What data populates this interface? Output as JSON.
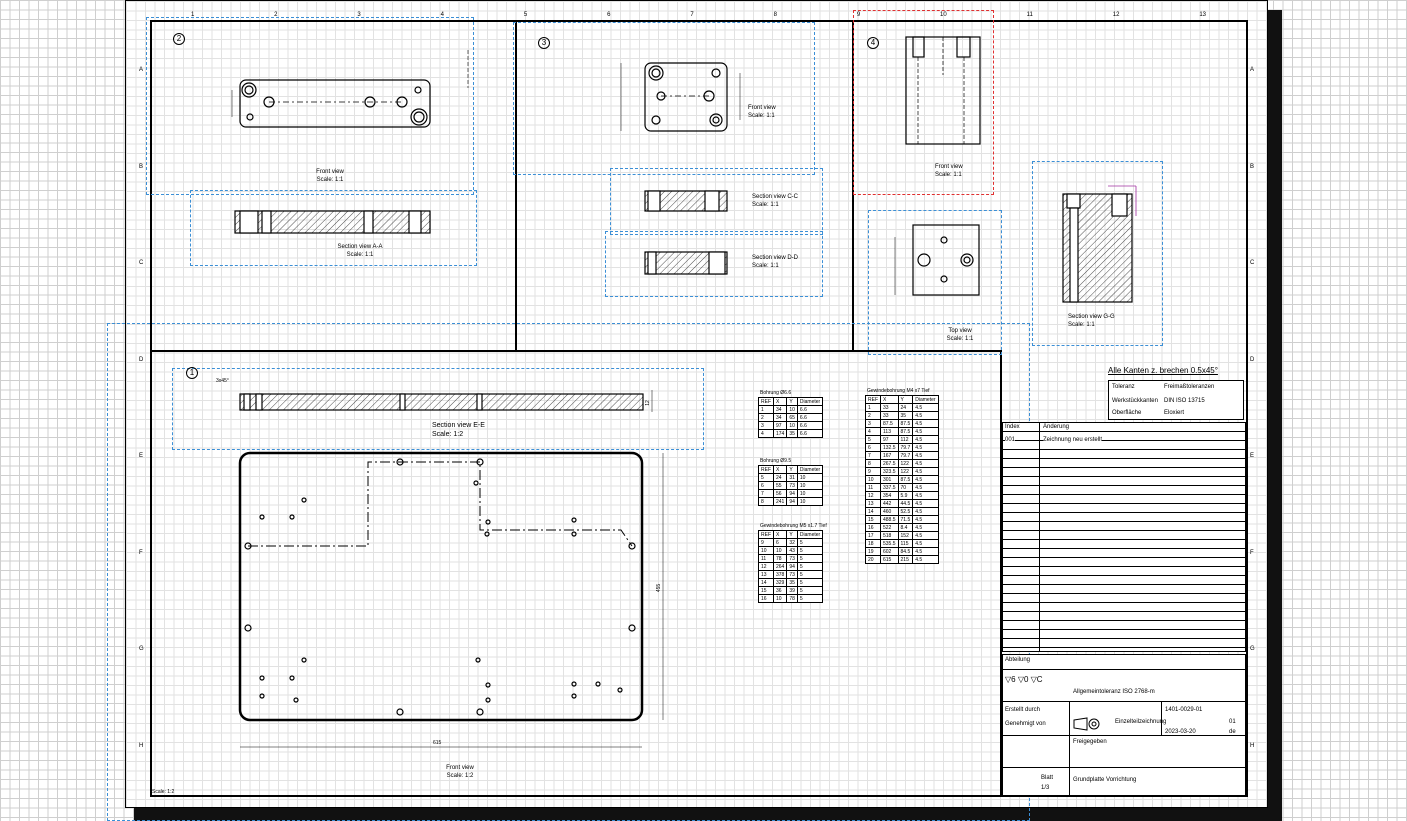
{
  "sheet": {
    "column_markers": [
      "1",
      "2",
      "3",
      "4",
      "5",
      "6",
      "7",
      "8",
      "9",
      "10",
      "11",
      "12",
      "13"
    ],
    "row_markers": [
      "A",
      "B",
      "C",
      "D",
      "E",
      "F",
      "G",
      "H"
    ],
    "footer_note": "Scale: 1:2"
  },
  "views": {
    "callouts": [
      "2",
      "3",
      "4",
      "1"
    ],
    "v2_front": "Front view\nScale: 1:1",
    "v2_section": "Section view A-A\nScale: 1:1",
    "v3_front": "Front view\nScale: 1:1",
    "v3_section_c": "Section view C-C\nScale: 1:1",
    "v3_section_d": "Section view D-D\nScale: 1:1",
    "v4_front": "Front view\nScale: 1:1",
    "v4_top": "Top view\nScale: 1:1",
    "v4_section": "Section view G-G\nScale: 1:1",
    "v1_section": "Section view E-E\nScale: 1:2",
    "v1_front": "Front view\nScale: 1:2",
    "dim_width": "615",
    "dim_height": "455",
    "dim_thk": "12",
    "edge_note": "3x45°"
  },
  "tables": {
    "t1": {
      "title": "Bohrung Ø6.6",
      "rows": [
        [
          "REF",
          "X",
          "Y",
          "Diameter"
        ],
        [
          "1",
          "34",
          "10",
          "6.6"
        ],
        [
          "2",
          "34",
          "65",
          "6.6"
        ],
        [
          "3",
          "97",
          "10",
          "6.6"
        ],
        [
          "4",
          "174",
          "35",
          "6.6"
        ]
      ]
    },
    "t2": {
      "title": "Bohrung Ø9.5",
      "rows": [
        [
          "REF",
          "X",
          "Y",
          "Diameter"
        ],
        [
          "5",
          "24",
          "31",
          "10"
        ],
        [
          "6",
          "55",
          "73",
          "10"
        ],
        [
          "7",
          "56",
          "94",
          "10"
        ],
        [
          "8",
          "241",
          "94",
          "10"
        ]
      ]
    },
    "t3": {
      "title": "Gewindebohrung M5 x1.7 Tief",
      "rows": [
        [
          "REF",
          "X",
          "Y",
          "Diameter"
        ],
        [
          "9",
          "6",
          "32",
          "5"
        ],
        [
          "10",
          "10",
          "43",
          "5"
        ],
        [
          "11",
          "78",
          "73",
          "5"
        ],
        [
          "12",
          "264",
          "94",
          "5"
        ],
        [
          "13",
          "378",
          "73",
          "5"
        ],
        [
          "14",
          "329",
          "35",
          "5"
        ],
        [
          "15",
          "36",
          "39",
          "5"
        ],
        [
          "16",
          "10",
          "78",
          "5"
        ]
      ]
    },
    "t4": {
      "title": "Gewindebohrung M4 x7 Tief",
      "rows": [
        [
          "REF",
          "X",
          "Y",
          "Diameter"
        ],
        [
          "1",
          "33",
          "24",
          "4.5"
        ],
        [
          "2",
          "33",
          "35",
          "4.5"
        ],
        [
          "3",
          "87.5",
          "87.5",
          "4.5"
        ],
        [
          "4",
          "113",
          "87.5",
          "4.5"
        ],
        [
          "5",
          "97",
          "112",
          "4.5"
        ],
        [
          "6",
          "132.5",
          "79.7",
          "4.5"
        ],
        [
          "7",
          "167",
          "79.7",
          "4.5"
        ],
        [
          "8",
          "267.5",
          "122",
          "4.5"
        ],
        [
          "9",
          "323.5",
          "122",
          "4.5"
        ],
        [
          "10",
          "301",
          "87.5",
          "4.5"
        ],
        [
          "11",
          "337.5",
          "70",
          "4.5"
        ],
        [
          "12",
          "354",
          "5.9",
          "4.5"
        ],
        [
          "13",
          "442",
          "44.5",
          "4.5"
        ],
        [
          "14",
          "460",
          "52.5",
          "4.5"
        ],
        [
          "15",
          "488.5",
          "71.5",
          "4.5"
        ],
        [
          "16",
          "522",
          "8.4",
          "4.5"
        ],
        [
          "17",
          "518",
          "152",
          "4.5"
        ],
        [
          "18",
          "535.5",
          "115",
          "4.5"
        ],
        [
          "19",
          "602",
          "84.5",
          "4.5"
        ],
        [
          "20",
          "615",
          "215",
          "4.5"
        ]
      ]
    }
  },
  "title_block": {
    "note": "Alle Kanten z. brechen 0.5x45°",
    "material_label": "Toleranz",
    "material_value": "Freimaßtoleranzen",
    "standard_label": "Werkstückkanten",
    "standard_value": "DIN ISO 13715",
    "surface_label": "Oberfläche",
    "surface_value": "Eloxiert",
    "rev_header_a": "Index",
    "rev_header_b": "Änderung",
    "rev_row_index": "001",
    "rev_row_text": "Zeichnung neu erstellt",
    "symbols": "▽6  ▽0  ▽C",
    "general_tol": "Allgemeintoleranz ISO 2768-m",
    "dept": "Abteilung",
    "created_by": "Erstellt durch",
    "approved_by": "Genehmigt von",
    "part_name": "Grundplatte Vorrichtung",
    "doc_type": "Einzelteilzeichnung",
    "state": "Freigegeben",
    "doc_number": "1401-0029-01",
    "rev": "01",
    "date": "2023-03-20",
    "lang": "de",
    "sheet_label": "Blatt",
    "sheet_value": "1/3",
    "projection": "proj-symbol"
  }
}
